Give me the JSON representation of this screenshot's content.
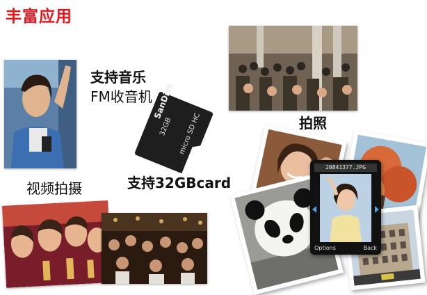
{
  "title": "丰富应用",
  "labels": {
    "music_line1": "支持音乐",
    "music_line2": "FM收音机",
    "card_support": "支持32GBcard",
    "video": "视频拍摄",
    "photo": "拍照"
  },
  "sd_card": {
    "brand": "SanDisk",
    "capacity": "32GB",
    "format": "micro SD HC"
  },
  "phone": {
    "filename": "20841377.JPG",
    "left_softkey": "Options",
    "right_softkey": "Back"
  },
  "colors": {
    "title": "#e8141c",
    "phone_arrow": "#4aa3e8"
  }
}
